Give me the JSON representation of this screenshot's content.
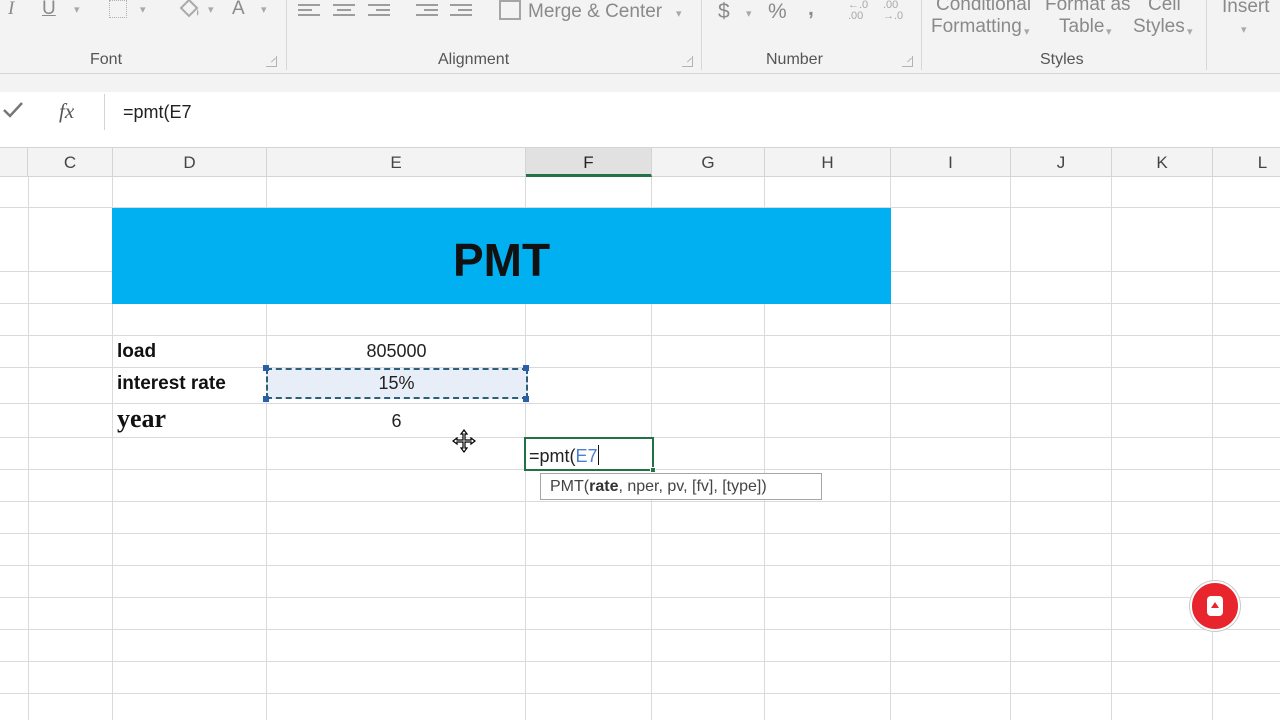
{
  "ribbon": {
    "font_group": {
      "label": "Font",
      "icons": [
        "italic-icon",
        "underline-icon",
        "borders-icon",
        "fill-color-icon",
        "font-color-icon"
      ],
      "italic": "I",
      "underline": "U",
      "font_color": "A"
    },
    "alignment_group": {
      "label": "Alignment",
      "merge_label": "Merge & Center"
    },
    "number_group": {
      "label": "Number",
      "currency": "$",
      "percent": "%",
      "comma": ",",
      "inc_decimal": "←.0\n.00",
      "dec_decimal": ".00\n→.0"
    },
    "styles_group": {
      "label": "Styles",
      "conditional_line1": "Conditional",
      "conditional_line2": "Formatting",
      "format_table_line1": "Format as",
      "format_table_line2": "Table",
      "cell_styles_line1": "Cell",
      "cell_styles_line2": "Styles"
    },
    "insert_label": "Insert"
  },
  "formula_bar": {
    "confirm_icon": "checkmark-icon",
    "fx_label": "fx",
    "content": "=pmt(E7"
  },
  "columns": [
    "C",
    "D",
    "E",
    "F",
    "G",
    "H",
    "I",
    "J",
    "K",
    "L"
  ],
  "selected_column": "F",
  "sheet": {
    "title": "PMT",
    "title_color": "#00b0f0",
    "rows": [
      {
        "label": "load",
        "value": "805000"
      },
      {
        "label": "interest rate",
        "value": "15%"
      },
      {
        "label": "year",
        "value": "6"
      }
    ],
    "active_cell": {
      "formula_prefix": "=pmt(",
      "formula_ref": "E7"
    },
    "tooltip": {
      "fn": "PMT(",
      "bold_arg": "rate",
      "rest": ", nper, pv, [fv], [type])"
    }
  },
  "accent_color": "#217346"
}
